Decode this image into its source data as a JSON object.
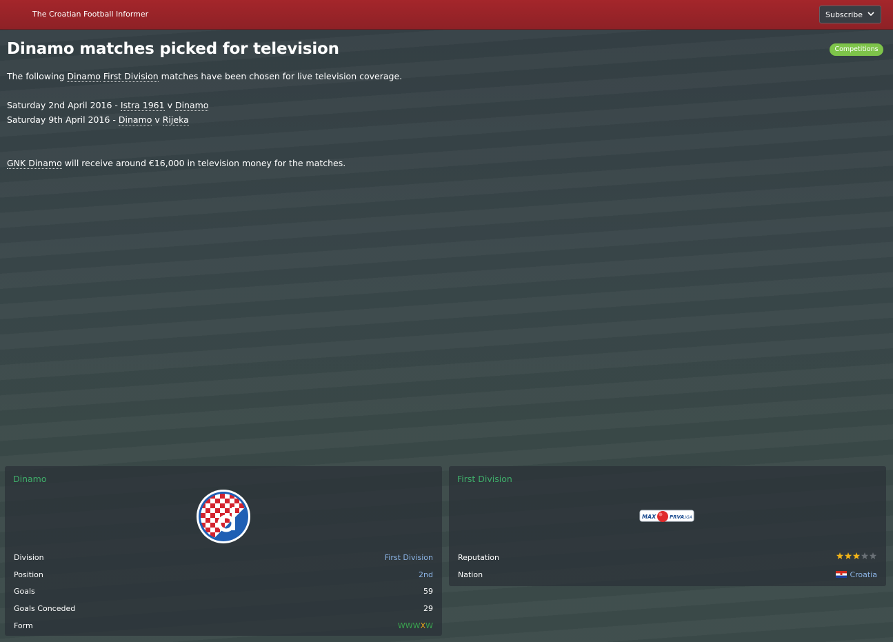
{
  "header": {
    "publication": "The Croatian Football Informer",
    "subscribe_label": "Subscribe"
  },
  "article": {
    "headline": "Dinamo matches picked for television",
    "category_badge": "Competitions",
    "intro": {
      "before": "The following ",
      "team_link": "Dinamo",
      "space": " ",
      "competition_link": "First Division",
      "after": " matches have been chosen for live television coverage."
    },
    "matches": [
      {
        "date": "Saturday 2nd April 2016 - ",
        "home": "Istra 1961",
        "vs": " v ",
        "away": "Dinamo"
      },
      {
        "date": "Saturday 9th April 2016 - ",
        "home": "Dinamo",
        "vs": " v ",
        "away": "Rijeka"
      }
    ],
    "money": {
      "club_link": "GNK Dinamo",
      "text": " will receive around €16,000 in television money for the matches."
    }
  },
  "club_card": {
    "title": "Dinamo",
    "logo_icon": "dinamo-zagreb-crest",
    "rows": [
      {
        "label": "Division",
        "value": "First Division"
      },
      {
        "label": "Position",
        "value": "2nd"
      },
      {
        "label": "Goals",
        "value": "59"
      },
      {
        "label": "Goals Conceded",
        "value": "29"
      },
      {
        "label": "Form",
        "value": ""
      }
    ],
    "form": [
      "W",
      "W",
      "W",
      "X",
      "W"
    ]
  },
  "league_card": {
    "title": "First Division",
    "logo_text": {
      "left": "MAX",
      "right": "PRVA",
      "right2": "LIGA"
    },
    "reputation_label": "Reputation",
    "reputation_stars": 3,
    "reputation_max": 5,
    "nation_label": "Nation",
    "nation_value": "Croatia"
  },
  "colors": {
    "topbar": "#9b2429",
    "accent_green": "#3fae6a",
    "badge_green": "#7ec44a",
    "link_blue": "#8cb4e6",
    "star_gold": "#f2b418",
    "form_win": "#3aa54f",
    "form_other": "#e6a219"
  }
}
